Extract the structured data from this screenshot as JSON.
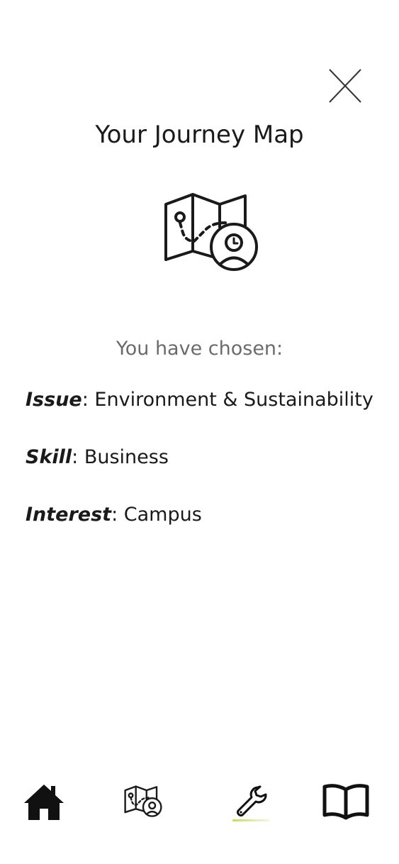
{
  "header": {
    "title": "Your Journey Map",
    "close_icon": "close-icon"
  },
  "hero": {
    "icon": "journey-map-icon"
  },
  "summary": {
    "intro": "You have chosen:",
    "issue_key": "Issue",
    "issue_value": ": Environment & Sustainability",
    "skill_key": "Skill",
    "skill_value": ": Business",
    "interest_key": "Interest",
    "interest_value": ": Campus"
  },
  "bottom_nav": {
    "items": [
      {
        "icon": "home-icon"
      },
      {
        "icon": "journey-map-icon"
      },
      {
        "icon": "wrench-icon",
        "active": true
      },
      {
        "icon": "book-icon"
      }
    ],
    "active_indicator_color": "#c6d94a"
  }
}
